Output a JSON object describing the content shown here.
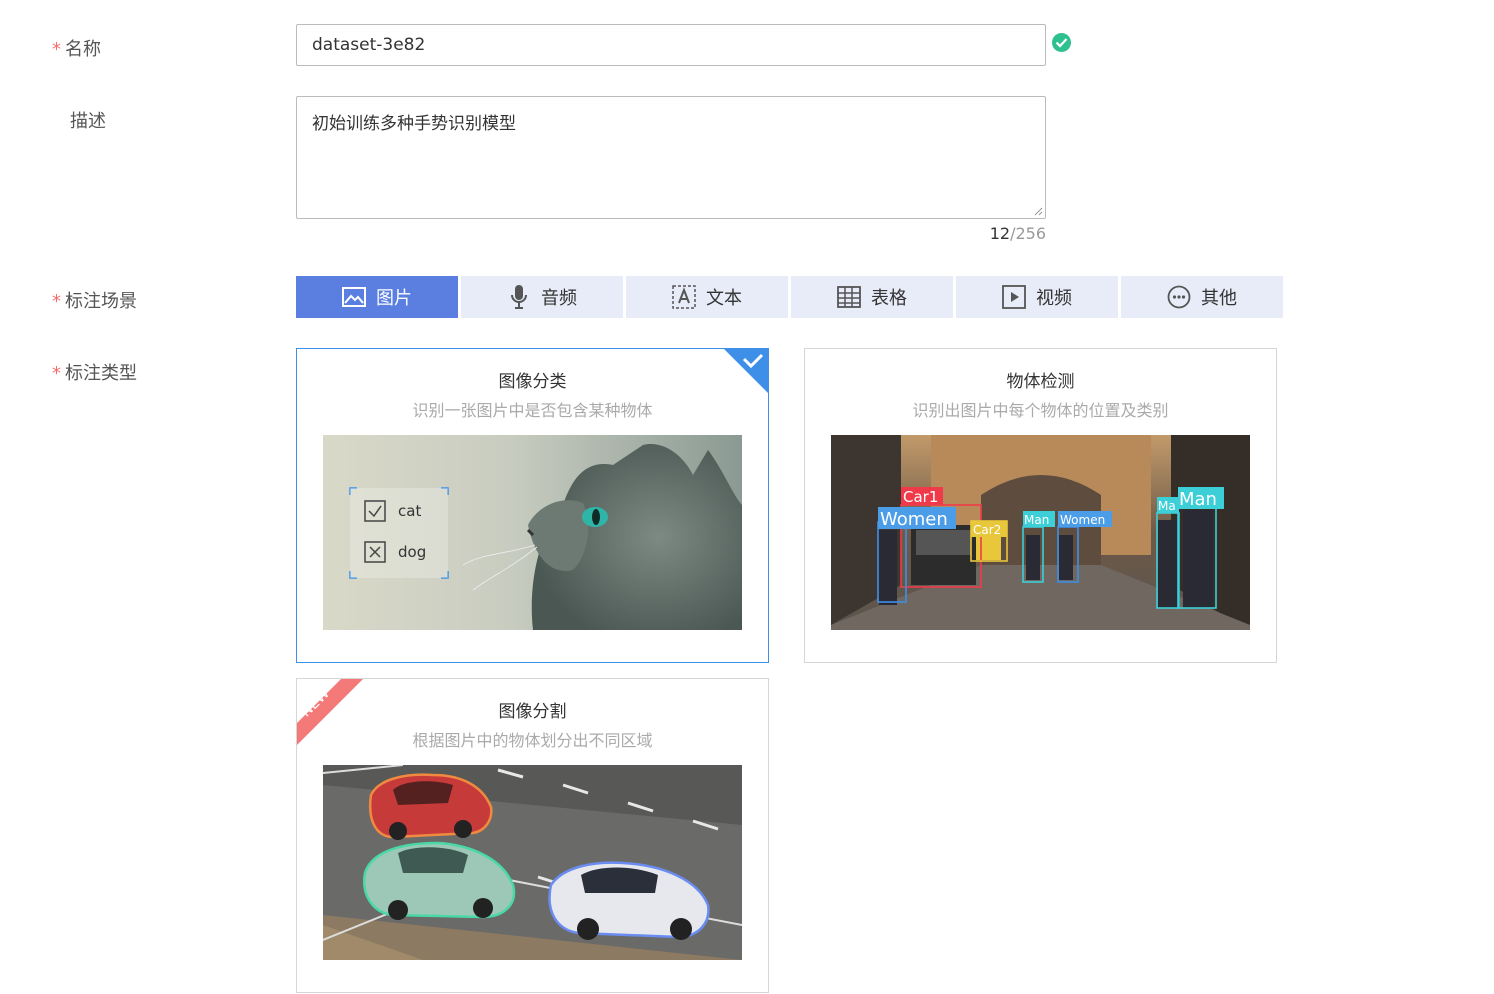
{
  "form": {
    "name_label": "名称",
    "name_value": "dataset-3e82",
    "desc_label": "描述",
    "desc_value": "初始训练多种手势识别模型",
    "desc_count": "12",
    "desc_max": "/256",
    "scene_label": "标注场景",
    "type_label": "标注类型"
  },
  "scenes": [
    {
      "label": "图片",
      "icon": "image-icon",
      "active": true
    },
    {
      "label": "音频",
      "icon": "microphone-icon",
      "active": false
    },
    {
      "label": "文本",
      "icon": "text-icon",
      "active": false
    },
    {
      "label": "表格",
      "icon": "table-icon",
      "active": false
    },
    {
      "label": "视频",
      "icon": "video-icon",
      "active": false
    },
    {
      "label": "其他",
      "icon": "more-icon",
      "active": false
    }
  ],
  "types": [
    {
      "title": "图像分类",
      "desc": "识别一张图片中是否包含某种物体",
      "selected": true,
      "image_labels": {
        "cat": "cat",
        "dog": "dog"
      }
    },
    {
      "title": "物体检测",
      "desc": "识别出图片中每个物体的位置及类别",
      "selected": false,
      "image_labels": {
        "car1": "Car1",
        "car2": "Car2",
        "women1": "Women",
        "man1": "Man",
        "women2": "Women",
        "ma": "Ma",
        "man2": "Man"
      }
    },
    {
      "title": "图像分割",
      "desc": "根据图片中的物体划分出不同区域",
      "selected": false,
      "badge": "NEW"
    }
  ],
  "colors": {
    "primary": "#5b7fe0",
    "scene_bg": "#e8ecf8",
    "required": "#f56c6c",
    "success": "#2ec08e",
    "selected_border": "#3d8fe8",
    "badge": "#f47a7a"
  }
}
